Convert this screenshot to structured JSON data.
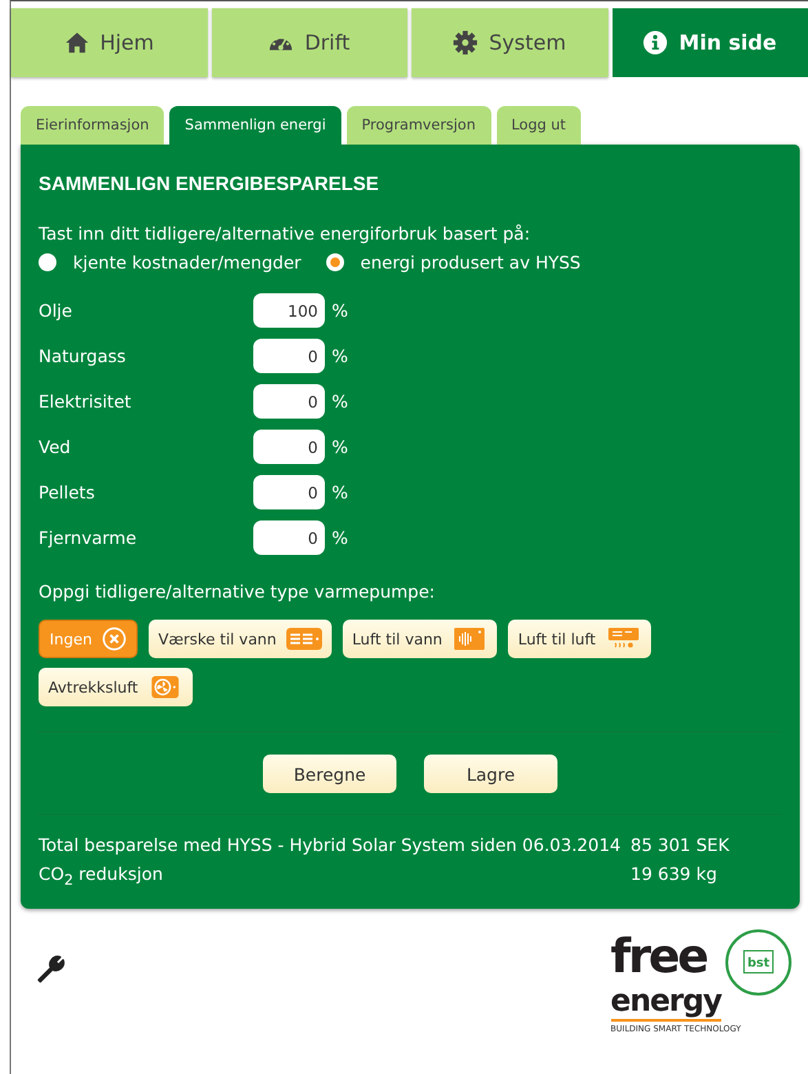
{
  "nav": [
    {
      "label": "Hjem",
      "kind": "home",
      "selected": false
    },
    {
      "label": "Drift",
      "kind": "gauge",
      "selected": false
    },
    {
      "label": "System",
      "kind": "gear",
      "selected": false
    },
    {
      "label": "Min side",
      "kind": "info",
      "selected": true
    }
  ],
  "subtabs": [
    {
      "label": "Eierinformasjon",
      "selected": false
    },
    {
      "label": "Sammenlign energi",
      "selected": true
    },
    {
      "label": "Programversjon",
      "selected": false
    },
    {
      "label": "Logg ut",
      "selected": false
    }
  ],
  "panel": {
    "title": "SAMMENLIGN ENERGIBESPARELSE",
    "basis_prompt": "Tast inn ditt tidligere/alternative energiforbruk basert på:",
    "basis_options": [
      {
        "label": "kjente kostnader/mengder",
        "selected": false
      },
      {
        "label": "energi produsert av HYSS",
        "selected": true
      }
    ],
    "sources": [
      {
        "label": "Olje",
        "value": "100",
        "unit": "%"
      },
      {
        "label": "Naturgass",
        "value": "0",
        "unit": "%"
      },
      {
        "label": "Elektrisitet",
        "value": "0",
        "unit": "%"
      },
      {
        "label": "Ved",
        "value": "0",
        "unit": "%"
      },
      {
        "label": "Pellets",
        "value": "0",
        "unit": "%"
      },
      {
        "label": "Fjernvarme",
        "value": "0",
        "unit": "%"
      }
    ],
    "pump_prompt": "Oppgi tidligere/alternative type varmepumpe:",
    "pumps": [
      {
        "label": "Ingen",
        "kind": "none",
        "selected": true
      },
      {
        "label": "Værske til vann",
        "kind": "liquid-water",
        "selected": false
      },
      {
        "label": "Luft til vann",
        "kind": "air-water",
        "selected": false
      },
      {
        "label": "Luft til luft",
        "kind": "air-air",
        "selected": false
      },
      {
        "label": "Avtrekksluft",
        "kind": "exhaust",
        "selected": false
      }
    ],
    "buttons": [
      "Beregne",
      "Lagre"
    ],
    "results": [
      {
        "label": "Total besparelse med HYSS - Hybrid Solar System siden 06.03.2014",
        "amount": "85 301",
        "unit": "SEK"
      },
      {
        "label": "CO$_{2}$ reduksjon",
        "amount": "19 639",
        "unit": "kg"
      }
    ]
  },
  "logo": {
    "word1": "free",
    "word2": "energy",
    "badge": "bst",
    "tagline": "BUILDING SMART TECHNOLOGY"
  }
}
